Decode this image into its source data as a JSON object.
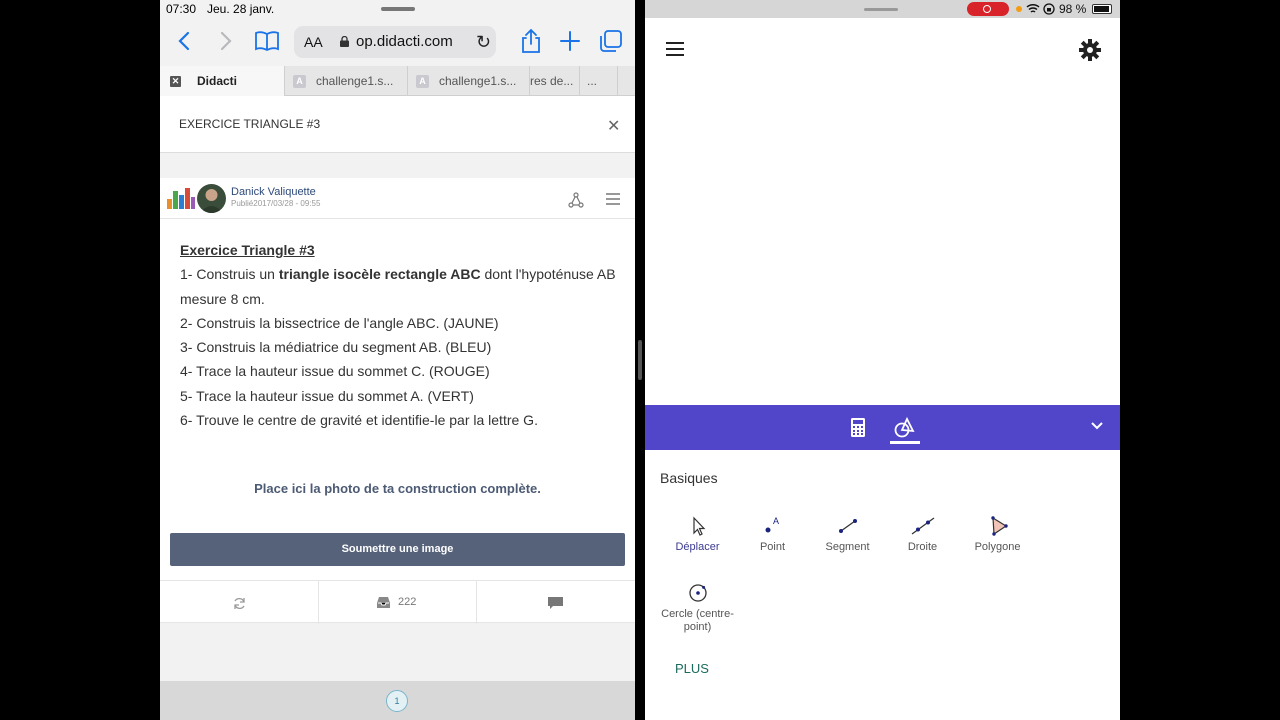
{
  "left": {
    "status": {
      "time": "07:30",
      "date": "Jeu. 28 janv."
    },
    "toolbar": {
      "aa_label": "AA",
      "url": "op.didacti.com"
    },
    "tabs": [
      {
        "label": "Didacti"
      },
      {
        "label": "challenge1.s..."
      },
      {
        "label": "challenge1.s..."
      },
      {
        "label": "res de..."
      },
      {
        "label": "..."
      }
    ],
    "exercise": {
      "title": "EXERCICE TRIANGLE #3",
      "close": "✕"
    },
    "post": {
      "author": "Danick Valiquette",
      "published": "Publié2017/03/28 - 09:55",
      "heading": "Exercice Triangle #3",
      "line1_pre": "1- Construis un ",
      "line1_bold": "triangle isocèle rectangle ABC",
      "line1_post": " dont l'hypoténuse AB mesure 8 cm.",
      "lines": [
        "2- Construis la bissectrice de l'angle ABC. (JAUNE)",
        "3- Construis la médiatrice du segment AB. (BLEU)",
        "4- Trace la hauteur issue du sommet C. (ROUGE)",
        "5- Trace la hauteur issue du sommet A. (VERT)",
        "6- Trouve le centre de gravité et identifie-le par la lettre G."
      ],
      "prompt": "Place ici la photo de ta construction complète.",
      "submit": "Soumettre une image",
      "submissions_count": "222"
    },
    "page_indicator": "1"
  },
  "right": {
    "battery": "98 %",
    "section_title": "Basiques",
    "tools": [
      {
        "label": "Déplacer",
        "icon": "cursor-icon"
      },
      {
        "label": "Point",
        "icon": "point-icon"
      },
      {
        "label": "Segment",
        "icon": "segment-icon"
      },
      {
        "label": "Droite",
        "icon": "line-icon"
      },
      {
        "label": "Polygone",
        "icon": "polygon-icon"
      },
      {
        "label": "Cercle (centre-point)",
        "icon": "circle-icon"
      }
    ],
    "more": "PLUS"
  },
  "colors": {
    "purple": "#5145c9",
    "submit": "#56627a",
    "link": "#1a73e8",
    "plus": "#1b6b5d"
  }
}
